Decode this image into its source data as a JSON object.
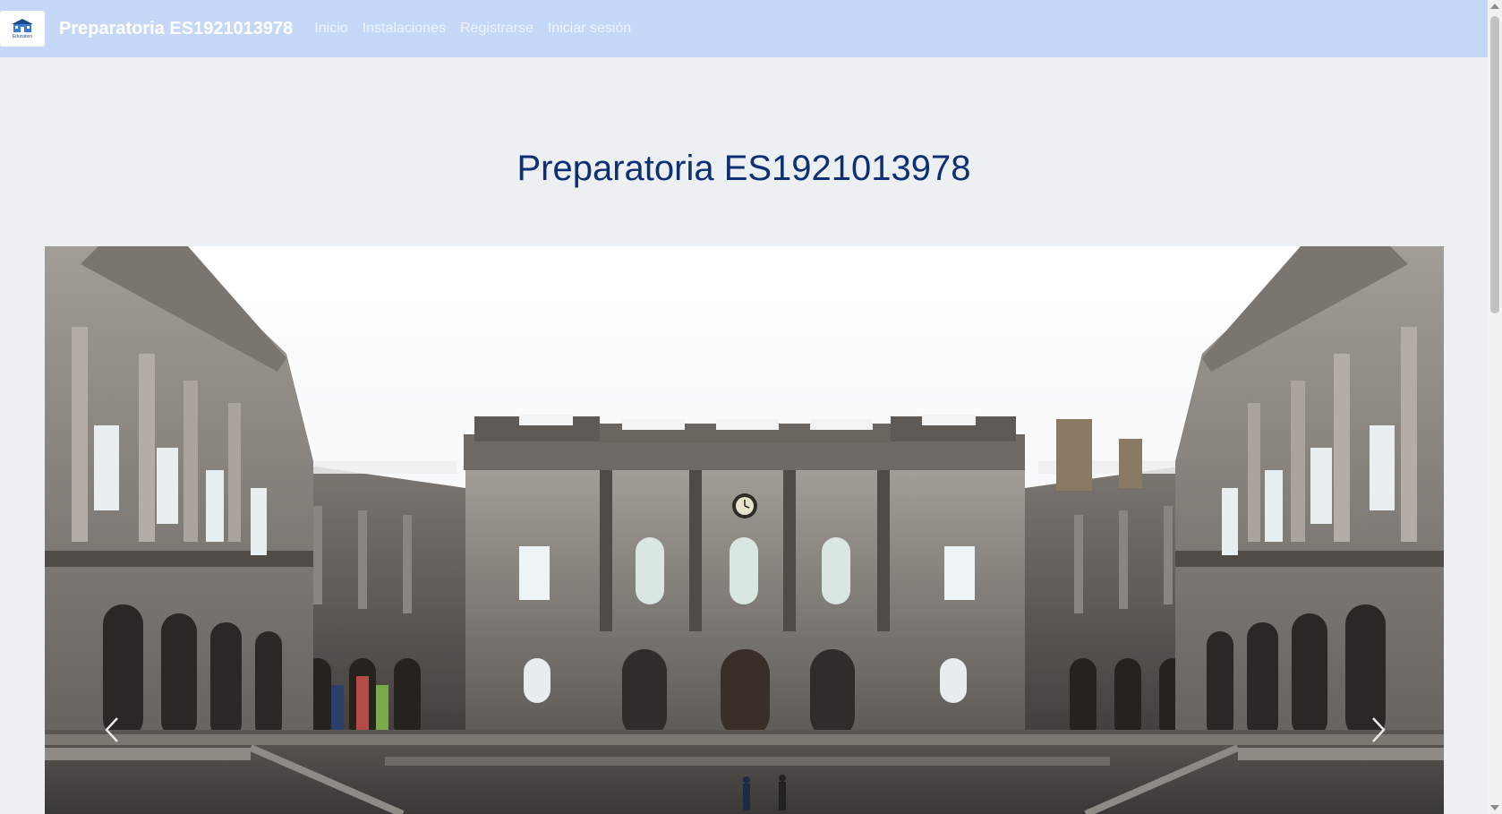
{
  "navbar": {
    "logo_text": "Education",
    "brand": "Preparatoria ES1921013978",
    "links": [
      "Inicio",
      "Instalaciones",
      "Registrarse",
      "Iniciar sesión"
    ]
  },
  "hero": {
    "title": "Preparatoria ES1921013978"
  },
  "carousel": {
    "image": "university-building-courtyard",
    "prev_icon": "chevron-left-icon",
    "next_icon": "chevron-right-icon"
  },
  "colors": {
    "navbar_bg": "#c6d8f7",
    "page_bg": "#edf0f3",
    "title": "#0e2f73",
    "stone": "#8f8a84"
  }
}
